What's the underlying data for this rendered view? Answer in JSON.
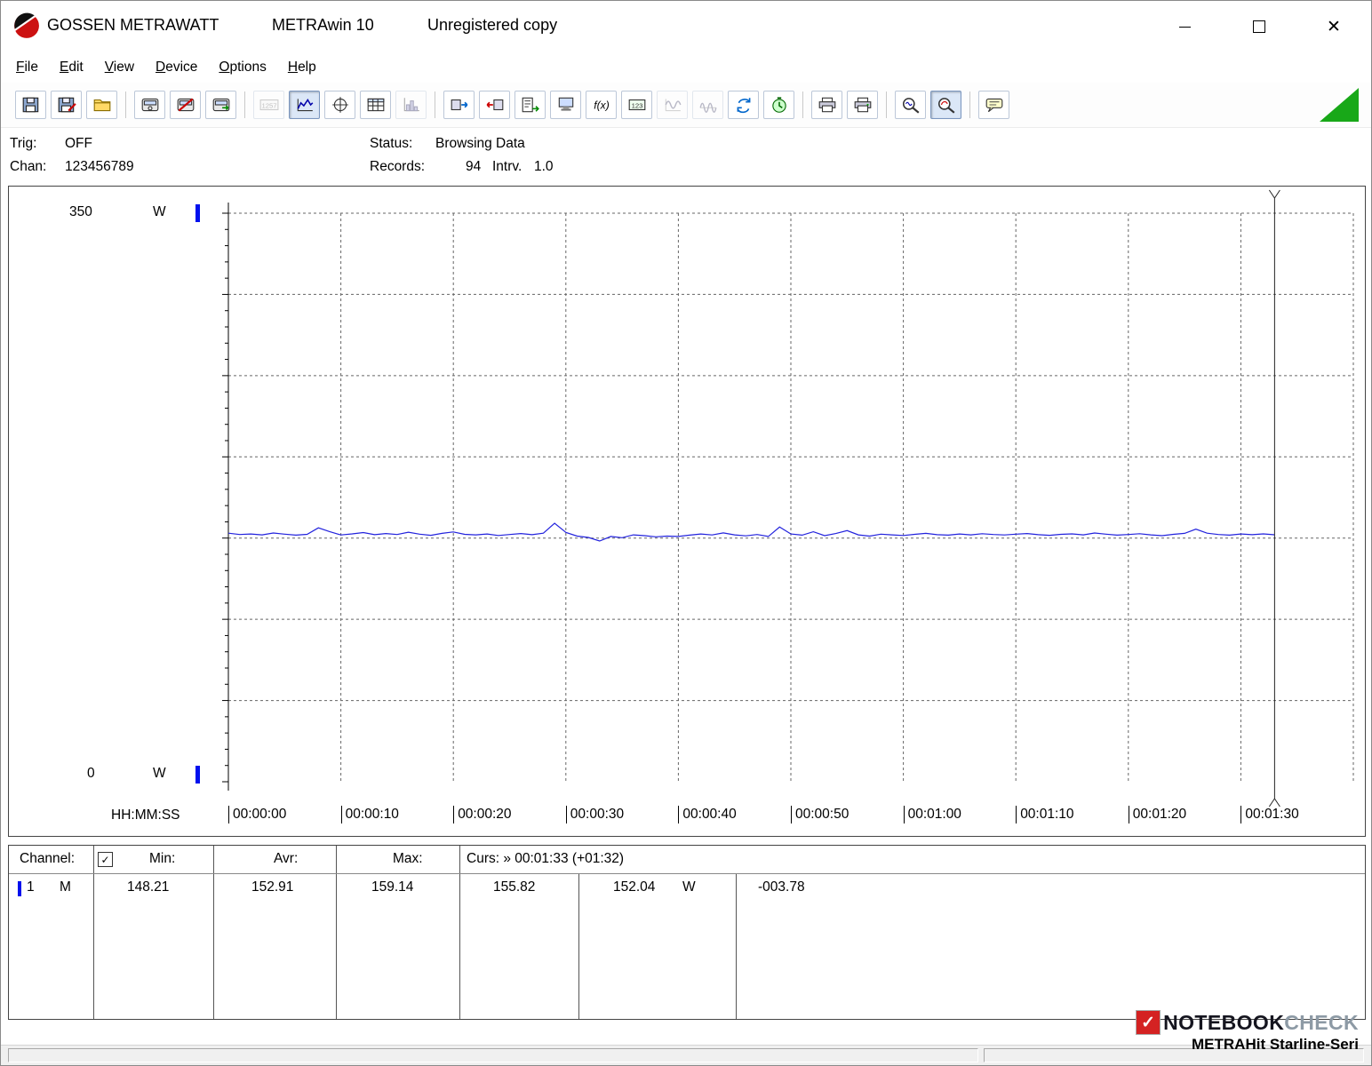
{
  "window": {
    "vendor": "GOSSEN METRAWATT",
    "title": "METRAwin 10",
    "license": "Unregistered copy"
  },
  "menu": {
    "items": [
      "File",
      "Edit",
      "View",
      "Device",
      "Options",
      "Help"
    ]
  },
  "toolbar": {
    "buttons": [
      {
        "name": "save",
        "icon": "floppy"
      },
      {
        "name": "save-as",
        "icon": "floppy2"
      },
      {
        "name": "open",
        "icon": "folder"
      },
      {
        "sep": true
      },
      {
        "name": "device-setup",
        "icon": "meter"
      },
      {
        "name": "device-disconnect",
        "icon": "meter2"
      },
      {
        "name": "device-connect",
        "icon": "meter3"
      },
      {
        "sep": true
      },
      {
        "name": "lcd-display",
        "icon": "lcd",
        "disabled": true
      },
      {
        "name": "view-trend",
        "icon": "trend",
        "pressed": true
      },
      {
        "name": "view-scope",
        "icon": "scope"
      },
      {
        "name": "view-table",
        "icon": "table"
      },
      {
        "name": "view-histogram",
        "icon": "histogram",
        "disabled": true
      },
      {
        "sep": true
      },
      {
        "name": "import-data",
        "icon": "boxarrow"
      },
      {
        "name": "export-data",
        "icon": "boxarrow2"
      },
      {
        "name": "read-list",
        "icon": "listarrow"
      },
      {
        "name": "read-memory",
        "icon": "monitor"
      },
      {
        "name": "formula",
        "icon": "fx"
      },
      {
        "name": "device-display",
        "icon": "lcd2"
      },
      {
        "name": "waveform-a",
        "icon": "sine",
        "disabled": true
      },
      {
        "name": "waveform-b",
        "icon": "sine2",
        "disabled": true
      },
      {
        "name": "data-exchange",
        "icon": "disks"
      },
      {
        "name": "timer",
        "icon": "clock"
      },
      {
        "sep": true
      },
      {
        "name": "print",
        "icon": "printer"
      },
      {
        "name": "print-preview",
        "icon": "printer2"
      },
      {
        "sep": true
      },
      {
        "name": "zoom-horizontal",
        "icon": "zoomwave"
      },
      {
        "name": "zoom-curve",
        "icon": "zoomcurve",
        "pressed": true
      },
      {
        "sep": true
      },
      {
        "name": "annotate",
        "icon": "note"
      }
    ]
  },
  "status": {
    "trig_label": "Trig:",
    "trig": "OFF",
    "chan_label": "Chan:",
    "chan": "123456789",
    "status_label": "Status:",
    "status": "Browsing Data",
    "records_label": "Records:",
    "records": "94",
    "intrv_label": "Intrv.",
    "intrv": "1.0"
  },
  "chart": {
    "y_max": "350",
    "y_min": "0",
    "unit_top": "W",
    "unit_bottom": "W",
    "x_label": "HH:MM:SS",
    "x_ticks": [
      "00:00:00",
      "00:00:10",
      "00:00:20",
      "00:00:30",
      "00:00:40",
      "00:00:50",
      "00:01:00",
      "00:01:10",
      "00:01:20",
      "00:01:30"
    ]
  },
  "chart_data": {
    "type": "line",
    "title": "Power consumption trend, channel 1",
    "ylabel": "W",
    "ylim": [
      0,
      350
    ],
    "xlabel": "HH:MM:SS",
    "x_domain_s": [
      0,
      100
    ],
    "interval_s": 1.0,
    "records": 94,
    "grid": true,
    "series_color": "#2222dd",
    "values": [
      153.0,
      152.2,
      152.5,
      152.0,
      153.1,
      152.4,
      151.8,
      152.3,
      156.3,
      154.0,
      151.9,
      152.6,
      153.4,
      152.1,
      152.8,
      152.2,
      153.6,
      152.4,
      151.7,
      152.9,
      153.8,
      152.3,
      152.0,
      152.5,
      151.6,
      152.2,
      152.8,
      152.1,
      153.0,
      159.14,
      153.5,
      151.2,
      150.4,
      148.21,
      151.0,
      150.2,
      152.0,
      151.5,
      150.8,
      151.2,
      151.0,
      151.8,
      152.5,
      151.9,
      153.2,
      152.0,
      151.4,
      152.2,
      151.0,
      156.8,
      152.5,
      151.8,
      153.9,
      151.5,
      152.8,
      154.6,
      152.0,
      151.2,
      152.4,
      152.0,
      151.6,
      152.3,
      152.9,
      152.1,
      151.8,
      152.5,
      152.0,
      152.7,
      152.2,
      151.9,
      152.4,
      152.8,
      152.1,
      151.7,
      152.3,
      152.6,
      152.0,
      153.1,
      152.4,
      151.8,
      152.2,
      152.7,
      152.0,
      151.5,
      152.3,
      152.9,
      155.5,
      153.0,
      152.2,
      151.8,
      152.5,
      152.1,
      152.6,
      152.04
    ],
    "stats": {
      "min": 148.21,
      "avr": 152.91,
      "max": 159.14
    },
    "cursor": {
      "record_s": 93,
      "time": "00:01:33",
      "offset": "+01:32",
      "value_a": 155.82,
      "value_b": 152.04,
      "delta": -3.78
    }
  },
  "readout": {
    "header": {
      "channel": "Channel:",
      "channel_checked": true,
      "min": "Min:",
      "avr": "Avr:",
      "max": "Max:",
      "curs": "Curs: » 00:01:33 (+01:32)"
    },
    "row": {
      "channel": "1",
      "mode": "M",
      "min": "148.21",
      "avr": "152.91",
      "max": "159.14",
      "curs_a": "155.82",
      "curs_b": "152.04",
      "unit": "W",
      "delta": "-003.78"
    }
  },
  "watermark": {
    "brand_a": "NOTEBOOK",
    "brand_b": "CHECK",
    "device": "METRAHit Starline-Seri"
  },
  "colors": {
    "accent_blue": "#0011ee",
    "series_blue": "#2222dd",
    "triangle_green": "#18a818",
    "brand_red": "#d42222"
  }
}
